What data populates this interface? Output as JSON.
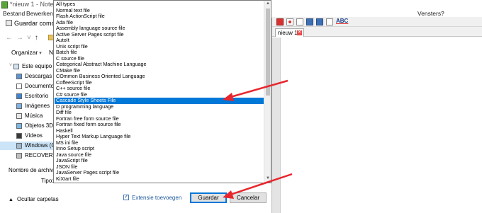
{
  "notepad": {
    "title": "*nieuw 1 - Notepad++",
    "menu": [
      "Bestand",
      "Bewerken",
      "Vensters",
      "?"
    ],
    "tab_label": "nieuw 1",
    "spellcheck_label": "ABC"
  },
  "dialog": {
    "title": "Guardar como",
    "organize_label": "Organizar",
    "new_folder_short": "N",
    "nav_items": [
      {
        "label": "Este equipo",
        "icon": "computer-icon"
      },
      {
        "label": "Descargas",
        "icon": "download-folder-icon"
      },
      {
        "label": "Documentos",
        "icon": "documents-folder-icon"
      },
      {
        "label": "Escritorio",
        "icon": "desktop-folder-icon"
      },
      {
        "label": "Imágenes",
        "icon": "pictures-folder-icon"
      },
      {
        "label": "Música",
        "icon": "music-folder-icon"
      },
      {
        "label": "Objetos 3D",
        "icon": "3d-objects-folder-icon"
      },
      {
        "label": "Vídeos",
        "icon": "videos-folder-icon"
      },
      {
        "label": "Windows (C:)",
        "icon": "drive-icon"
      },
      {
        "label": "RECOVERY (D:)",
        "icon": "drive-icon"
      }
    ],
    "filename_label": "Nombre de archivo:",
    "filetype_label": "Tipo:",
    "hide_folders_label": "Ocultar carpetas",
    "ext_checkbox_label": "Extensie toevoegen",
    "save_button": "Guardar",
    "cancel_button": "Cancelar"
  },
  "file_types": {
    "selected_index": 16,
    "items": [
      "All types",
      "Normal text file",
      "Flash ActionScript file",
      "Ada file",
      "Assembly language source file",
      "Active Server Pages script file",
      "AutoIt",
      "Unix script file",
      "Batch file",
      "C source file",
      "Categorical Abstract Machine Language",
      "CMake file",
      "COmmon Business Oriented Language",
      "CoffeeScript file",
      "C++ source file",
      "C# source file",
      "Cascade Style Sheets File",
      "D programming language",
      "Diff file",
      "Fortran free form source file",
      "Fortran fixed form source file",
      "Haskell",
      "Hyper Text Markup Language file",
      "MS ini file",
      "Inno Setup script",
      "Java source file",
      "JavaScript file",
      "JSON file",
      "JavaServer Pages script file",
      "KiXtart file"
    ]
  },
  "colors": {
    "selection": "#0078d7",
    "annotation_arrow": "#e8262d"
  }
}
